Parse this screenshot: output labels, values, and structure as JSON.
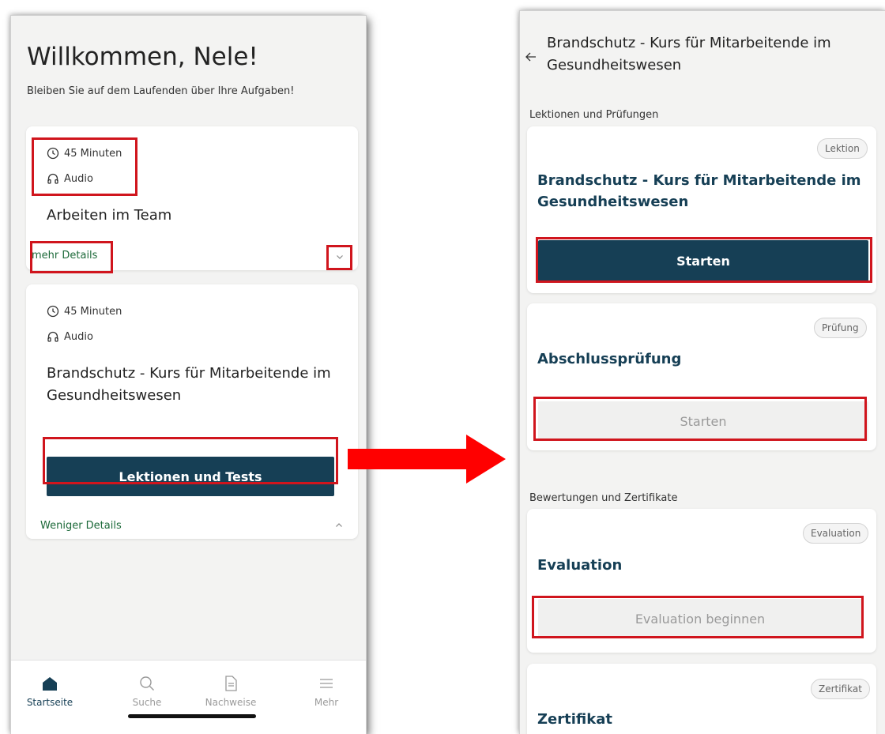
{
  "left_screen": {
    "welcome_title": "Willkommen, Nele!",
    "welcome_subtitle": "Bleiben Sie auf dem Laufenden über Ihre Aufgaben!",
    "course1": {
      "duration": "45 Minuten",
      "format": "Audio",
      "title": "Arbeiten im Team",
      "details_link": "mehr Details"
    },
    "course2": {
      "duration": "45 Minuten",
      "format": "Audio",
      "title_line1": "Brandschutz - Kurs für Mitarbeitende im",
      "title_line2": "Gesundheitswesen",
      "button_label": "Lektionen und Tests",
      "details_link": "Weniger Details"
    },
    "nav": {
      "home": "Startseite",
      "search": "Suche",
      "records": "Nachweise",
      "more": "Mehr"
    }
  },
  "right_screen": {
    "header_title_line1": "Brandschutz - Kurs für Mitarbeitende im",
    "header_title_line2": "Gesundheitswesen",
    "section_lessons": "Lektionen und Prüfungen",
    "lesson_card": {
      "badge": "Lektion",
      "title_line1": "Brandschutz - Kurs für Mitarbeitende im",
      "title_line2": "Gesundheitswesen",
      "button": "Starten"
    },
    "exam_card": {
      "badge": "Prüfung",
      "title": "Abschlussprüfung",
      "button": "Starten"
    },
    "section_ratings": "Bewertungen und Zertifikate",
    "evaluation_card": {
      "badge": "Evaluation",
      "title": "Evaluation",
      "button": "Evaluation beginnen"
    },
    "certificate_card": {
      "badge": "Zertifikat",
      "title": "Zertifikat"
    }
  },
  "colors": {
    "primary": "#163f55",
    "highlight": "#d0151d",
    "link_green": "#1d6a3a",
    "arrow_red": "#ff0000"
  },
  "icons": {
    "clock": "clock-icon",
    "headphones": "headphones-icon",
    "chevron_down": "chevron-down-icon",
    "chevron_up": "chevron-up-icon",
    "back_arrow": "back-arrow-icon",
    "home": "home-icon",
    "search": "search-icon",
    "document": "document-icon",
    "menu": "menu-icon"
  }
}
